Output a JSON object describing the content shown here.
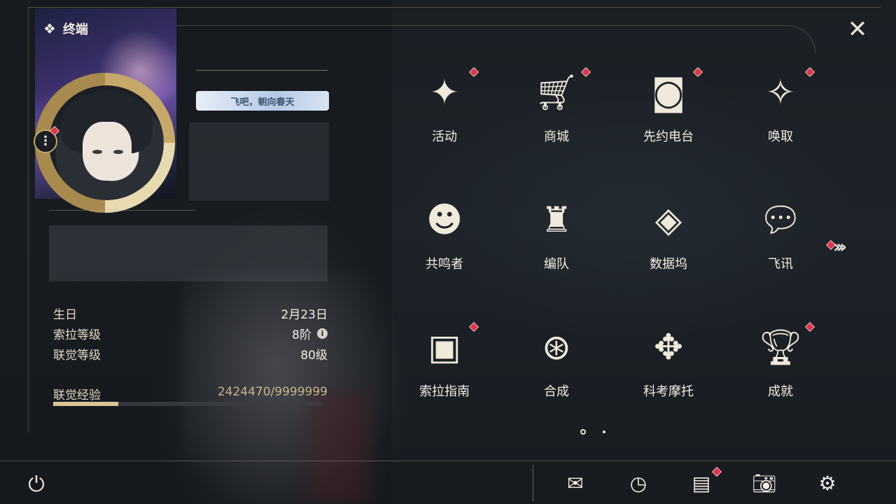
{
  "header": {
    "title": "终端",
    "logo_icon": "diamond-cluster-icon",
    "close_icon": "close-x-icon"
  },
  "profile": {
    "title_badge": "飞吧，朝向春天",
    "menu_icon": "more-vertical-icon"
  },
  "stats": [
    {
      "label": "生日",
      "value": "2月23日"
    },
    {
      "label": "索拉等级",
      "value": "8阶",
      "has_info": true
    },
    {
      "label": "联觉等级",
      "value": "80级"
    }
  ],
  "experience": {
    "label": "联觉经验",
    "value": "2424470/9999999",
    "progress": 0.2424
  },
  "menu": [
    {
      "label": "活动",
      "icon": "sparkle-icon",
      "badge": true
    },
    {
      "label": "商城",
      "icon": "shopping-cart-icon",
      "badge": true
    },
    {
      "label": "先约电台",
      "icon": "radio-icon",
      "badge": true
    },
    {
      "label": "唤取",
      "icon": "compass-star-icon",
      "badge": true
    },
    {
      "label": "共鸣者",
      "icon": "character-head-icon",
      "badge": false
    },
    {
      "label": "编队",
      "icon": "chess-piece-icon",
      "badge": false
    },
    {
      "label": "数据坞",
      "icon": "data-dock-icon",
      "badge": false
    },
    {
      "label": "飞讯",
      "icon": "message-bubble-icon",
      "badge": false
    },
    {
      "label": "索拉指南",
      "icon": "guide-book-icon",
      "badge": true
    },
    {
      "label": "合成",
      "icon": "synthesis-icon",
      "badge": false
    },
    {
      "label": "科考摩托",
      "icon": "motorbike-icon",
      "badge": false
    },
    {
      "label": "成就",
      "icon": "trophy-icon",
      "badge": true
    }
  ],
  "pager": {
    "current": 1,
    "total": 2,
    "next_icon": "double-chevron-right-icon"
  },
  "bottom_bar": [
    {
      "name": "mail",
      "icon": "mail-icon",
      "badge": false
    },
    {
      "name": "clock",
      "icon": "clock-icon",
      "badge": false
    },
    {
      "name": "notes",
      "icon": "notes-icon",
      "badge": true
    },
    {
      "name": "camera",
      "icon": "camera-icon",
      "badge": false
    },
    {
      "name": "settings",
      "icon": "gear-icon",
      "badge": false
    }
  ],
  "power_icon": "power-icon",
  "colors": {
    "accent_gold": "#c8a86a",
    "badge_red": "#d8394a",
    "text": "#f2eee4"
  }
}
